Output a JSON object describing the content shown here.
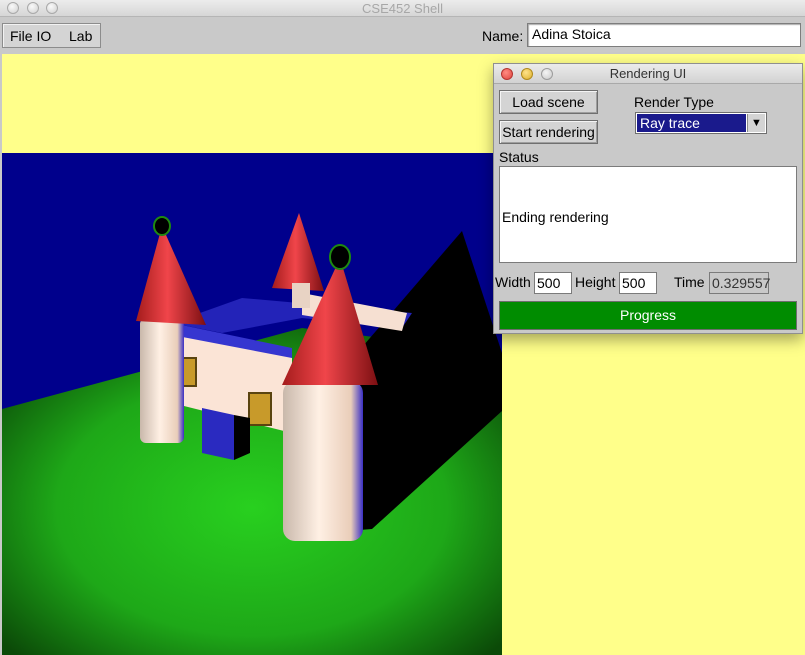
{
  "window": {
    "title": "CSE452 Shell"
  },
  "menu": {
    "items": [
      "File IO",
      "Lab"
    ]
  },
  "name_field": {
    "label": "Name:",
    "value": "Adina Stoica"
  },
  "rendering_ui": {
    "title": "Rendering UI",
    "load_scene_label": "Load scene",
    "start_rendering_label": "Start rendering",
    "render_type_label": "Render Type",
    "render_type_value": "Ray trace",
    "status_label": "Status",
    "status_text": "Ending rendering",
    "width_label": "Width",
    "width_value": "500",
    "height_label": "Height",
    "height_value": "500",
    "time_label": "Time",
    "time_value": "0.329557",
    "progress_label": "Progress",
    "progress_fraction": 1.0
  },
  "colors": {
    "viewport_background": "#ffff8a",
    "sky": "#00008c",
    "ground": "#22cc1a",
    "progress": "#008c00",
    "selection": "#1a1a8c"
  },
  "icons": {
    "close": "close-icon",
    "minimize": "minimize-icon",
    "zoom": "zoom-icon",
    "dropdown": "chevron-down-icon"
  }
}
